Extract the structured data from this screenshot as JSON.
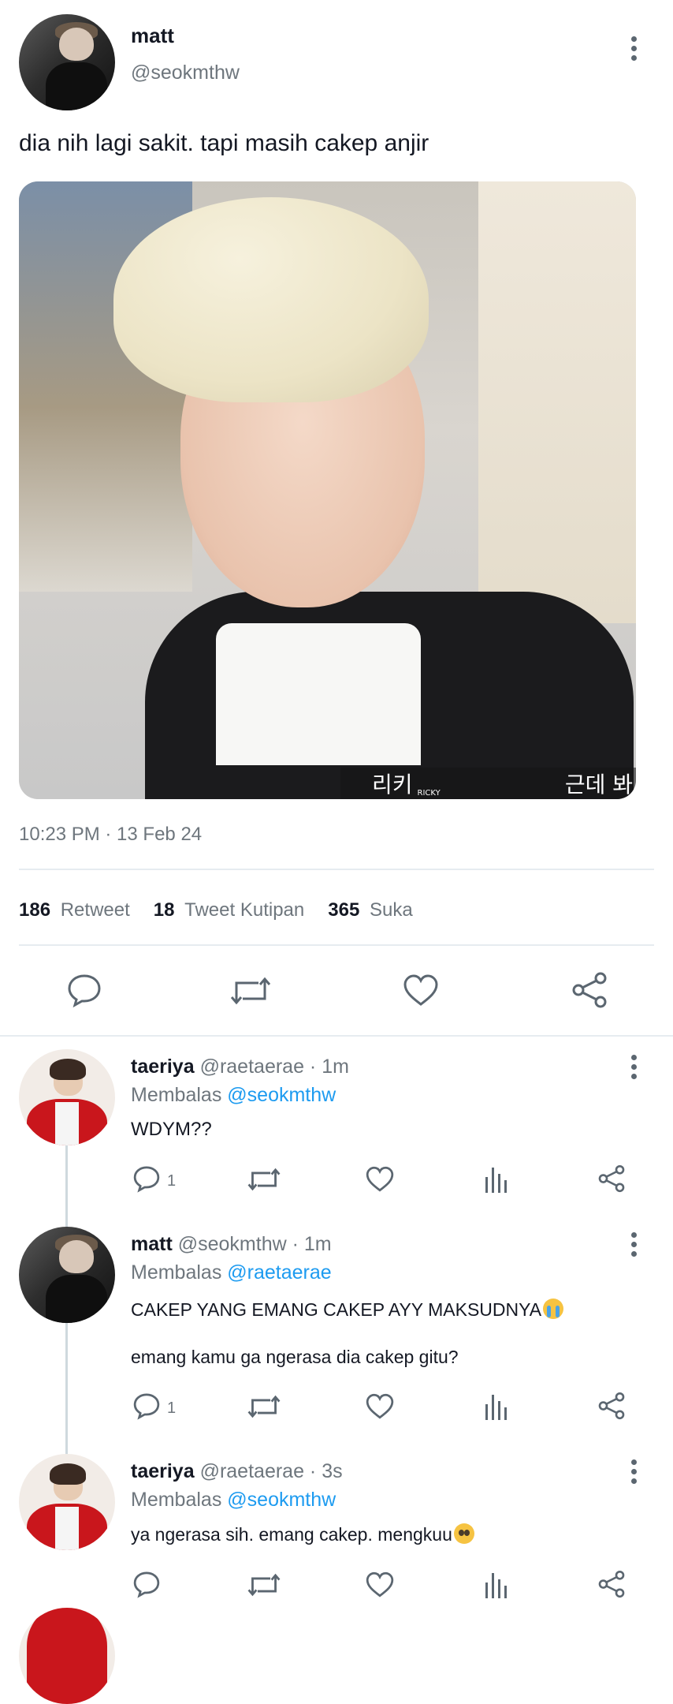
{
  "main_tweet": {
    "author_name": "matt",
    "author_handle": "@seokmthw",
    "text": "dia nih lagi sakit. tapi masih cakep anjir",
    "media_caption_left": "리키",
    "media_caption_sub": "RICKY",
    "media_caption_right": "근데 봐",
    "timestamp": "10:23 PM · 13 Feb 24",
    "stats": [
      {
        "count": "186",
        "label": "Retweet"
      },
      {
        "count": "18",
        "label": "Tweet Kutipan"
      },
      {
        "count": "365",
        "label": "Suka"
      }
    ]
  },
  "replies": [
    {
      "name": "taeriya",
      "meta": "@raetaerae · 1m",
      "replying_prefix": "Membalas",
      "replying_to": "@seokmthw",
      "text": "WDYM??",
      "reply_count": "1"
    },
    {
      "name": "matt",
      "meta": "@seokmthw · 1m",
      "replying_prefix": "Membalas",
      "replying_to": "@raetaerae",
      "text": "CAKEP YANG EMANG CAKEP AYY MAKSUDNYA",
      "text2": "emang kamu ga ngerasa dia cakep gitu?",
      "reply_count": "1"
    },
    {
      "name": "taeriya",
      "meta": "@raetaerae · 3s",
      "replying_prefix": "Membalas",
      "replying_to": "@seokmthw",
      "text": "ya ngerasa sih. emang cakep. mengkuu",
      "reply_count": ""
    }
  ],
  "icons": {
    "reply": "speech-bubble-icon",
    "retweet": "retweet-icon",
    "like": "heart-icon",
    "views": "bar-chart-icon",
    "share": "share-icon",
    "more": "vertical-dots-icon"
  },
  "colors": {
    "link": "#1d9bf0",
    "muted": "#6e767d",
    "icon": "#5b6670"
  }
}
